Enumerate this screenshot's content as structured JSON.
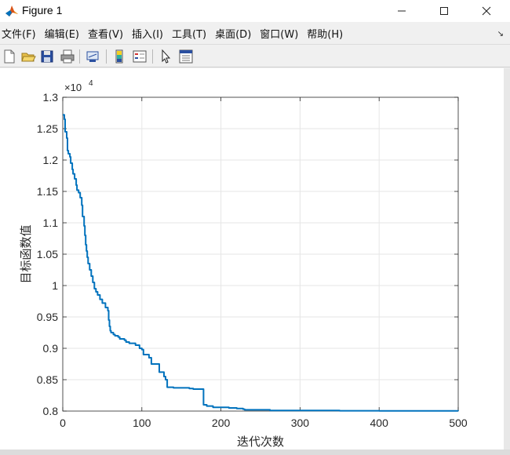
{
  "window": {
    "title": "Figure 1",
    "minimize_glyph": "—",
    "close_glyph": "✕"
  },
  "menubar": {
    "items": [
      "文件(F)",
      "编辑(E)",
      "查看(V)",
      "插入(I)",
      "工具(T)",
      "桌面(D)",
      "窗口(W)",
      "帮助(H)"
    ],
    "dock_glyph": "↘"
  },
  "toolbar": {
    "icons": [
      "new-figure-icon",
      "open-file-icon",
      "save-icon",
      "print-icon",
      "link-plot-icon",
      "insert-colorbar-icon",
      "insert-legend-icon",
      "select-pointer-icon",
      "property-inspector-icon"
    ]
  },
  "colors": {
    "line": "#0072bd",
    "grid": "#e6e6e6",
    "axis": "#262626",
    "window_bg": "#f0f0f0"
  },
  "chart_data": {
    "type": "line",
    "xlabel": "迭代次数",
    "ylabel": "目标函数值",
    "exponent_label": "×10",
    "exponent_power": "4",
    "xlim": [
      0,
      500
    ],
    "ylim": [
      0.8,
      1.3
    ],
    "grid": true,
    "xticks": [
      "0",
      "100",
      "200",
      "300",
      "400",
      "500"
    ],
    "yticks": [
      "0.8",
      "0.85",
      "0.9",
      "0.95",
      "1",
      "1.05",
      "1.1",
      "1.15",
      "1.2",
      "1.25",
      "1.3"
    ],
    "series": [
      {
        "x": [
          0,
          2,
          3,
          5,
          6,
          7,
          9,
          10,
          12,
          13,
          15,
          17,
          18,
          20,
          22,
          24,
          25,
          27,
          28,
          29,
          30,
          31,
          32,
          34,
          36,
          38,
          40,
          42,
          44,
          47,
          50,
          54,
          56,
          57,
          58,
          59,
          60,
          61,
          64,
          66,
          70,
          72,
          78,
          80,
          84,
          88,
          92,
          97,
          100,
          102,
          109,
          112,
          122,
          128,
          130,
          132,
          140,
          150,
          160,
          165,
          175,
          178,
          182,
          190,
          195,
          200,
          210,
          220,
          228,
          230,
          245,
          262,
          300,
          350,
          400,
          450,
          500
        ],
        "y": [
          1.272,
          1.265,
          1.245,
          1.235,
          1.215,
          1.21,
          1.205,
          1.195,
          1.185,
          1.178,
          1.17,
          1.16,
          1.152,
          1.148,
          1.14,
          1.128,
          1.11,
          1.095,
          1.08,
          1.065,
          1.055,
          1.045,
          1.035,
          1.025,
          1.015,
          1.005,
          0.995,
          0.99,
          0.985,
          0.978,
          0.972,
          0.965,
          0.965,
          0.96,
          0.945,
          0.935,
          0.928,
          0.925,
          0.922,
          0.92,
          0.918,
          0.915,
          0.913,
          0.91,
          0.908,
          0.908,
          0.905,
          0.9,
          0.898,
          0.89,
          0.885,
          0.875,
          0.862,
          0.855,
          0.85,
          0.838,
          0.837,
          0.837,
          0.836,
          0.835,
          0.835,
          0.81,
          0.808,
          0.806,
          0.806,
          0.806,
          0.805,
          0.804,
          0.803,
          0.802,
          0.802,
          0.801,
          0.801,
          0.8005,
          0.8003,
          0.8002,
          0.8001
        ]
      }
    ]
  }
}
